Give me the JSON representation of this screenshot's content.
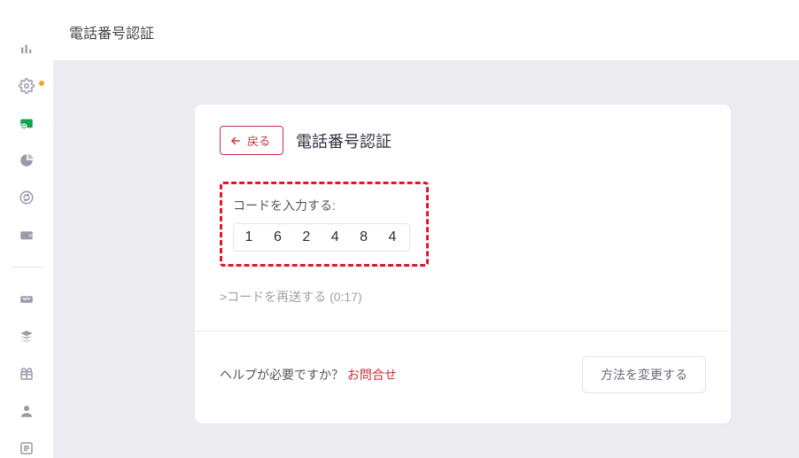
{
  "page_title": "電話番号認証",
  "card": {
    "back_label": "戻る",
    "title": "電話番号認証",
    "code_label": "コードを入力する:",
    "code_digits": [
      "1",
      "6",
      "2",
      "4",
      "8",
      "4"
    ],
    "resend_prefix": ">コードを再送する (",
    "resend_timer": "0:17",
    "resend_suffix": ")"
  },
  "footer": {
    "help_question": "ヘルプが必要ですか？ ",
    "contact_label": "お問合せ",
    "change_method_label": "方法を変更する"
  },
  "sidebar": {
    "icons": [
      "chart-bar-icon",
      "gear-icon",
      "deposit-icon",
      "pie-icon",
      "refresh-circle-icon",
      "wallet-icon",
      "activity-icon",
      "layers-icon",
      "gift-icon",
      "user-icon",
      "list-icon"
    ]
  }
}
